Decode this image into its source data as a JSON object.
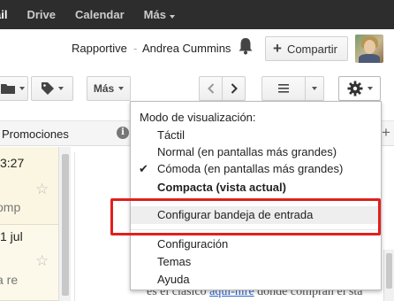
{
  "topbar": {
    "items": [
      "ail",
      "Drive",
      "Calendar",
      "Más"
    ]
  },
  "account": {
    "rapportive": "Rapportive",
    "separator": "-",
    "user_name": "Andrea Cummins",
    "share_label": "Compartir"
  },
  "toolbar": {
    "more_label": "Más"
  },
  "tabs": {
    "promotions": "Promociones",
    "info_glyph": "i",
    "add_glyph": "+"
  },
  "mail_list": [
    {
      "time": "3:27",
      "snippet": "omp"
    },
    {
      "time": "1 jul",
      "snippet": "a re"
    }
  ],
  "reading_pane": {
    "text_before": "es el clásico ",
    "link_text": "aqui-hire",
    "text_after": " donde compran el sta"
  },
  "settings_menu": {
    "header": "Modo de visualización:",
    "density_options": [
      {
        "label": "Táctil",
        "checked": false,
        "bold": false
      },
      {
        "label": "Normal (en pantallas más grandes)",
        "checked": false,
        "bold": false
      },
      {
        "label": "Cómoda (en pantallas más grandes)",
        "checked": true,
        "bold": false
      },
      {
        "label": "Compacta (vista actual)",
        "checked": false,
        "bold": true
      }
    ],
    "configure_inbox": "Configurar bandeja de entrada",
    "settings": "Configuración",
    "themes": "Temas",
    "help": "Ayuda"
  },
  "colors": {
    "topbar_bg": "#2d2d2d",
    "annotation": "#e0201d",
    "list_bg": "#fbf6e2"
  }
}
